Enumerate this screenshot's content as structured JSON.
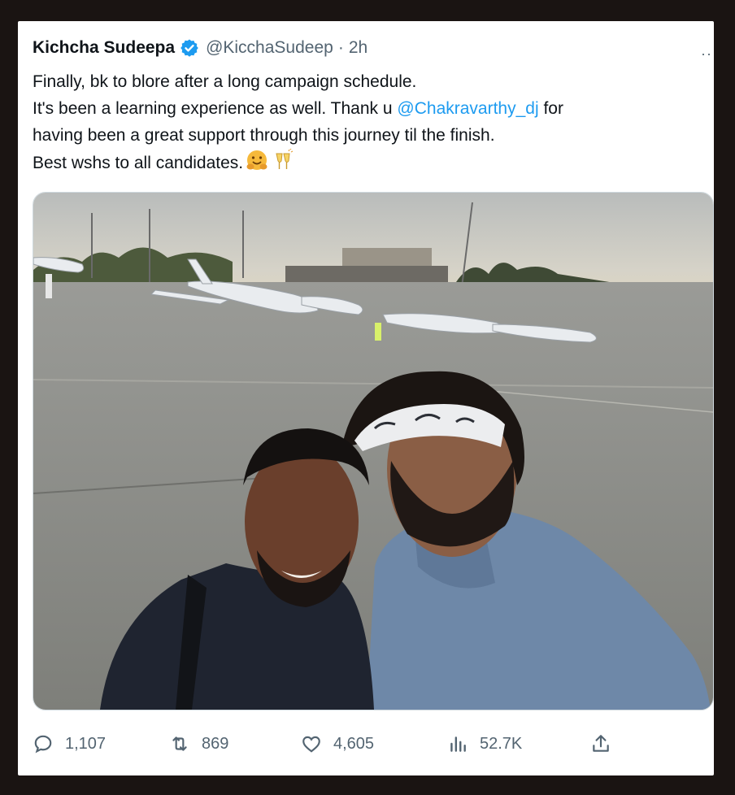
{
  "tweet": {
    "author_name": "Kichcha Sudeepa",
    "handle": "@KicchaSudeep",
    "separator": "·",
    "time": "2h",
    "more_label": "··",
    "text": {
      "line1": "Finally, bk to blore after a long campaign schedule.",
      "line2_before": "It's been a learning experience as well. Thank u ",
      "mention": "@Chakravarthy_dj",
      "line2_after": " for",
      "line3": "having been a great support through this journey til the finish.",
      "line4": "Best wshs to all candidates."
    },
    "emojis": [
      "hugging-face-emoji",
      "clinking-glasses-emoji"
    ]
  },
  "media": {
    "description_icon": "photo",
    "colors": {
      "sky": "#c9cbc8",
      "tarmac": "#8d8e89",
      "shirt_blue": "#6e88a8",
      "dark_shirt": "#1f2430"
    }
  },
  "actions": {
    "replies": "1,107",
    "reposts": "869",
    "likes": "4,605",
    "views": "52.7K"
  },
  "colors": {
    "verified": "#1d9bf0",
    "mention": "#1d9bf0",
    "muted": "#536471"
  }
}
